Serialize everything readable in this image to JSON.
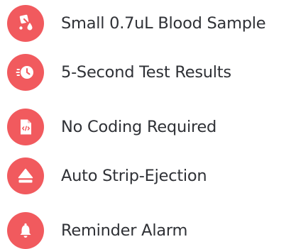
{
  "colors": {
    "accent": "#F15A5E",
    "text": "#2F3136",
    "icon_glyph": "#FFFFFF"
  },
  "features": [
    {
      "label": "Small 0.7uL Blood Sample",
      "icon": "blood-drop-strip-icon"
    },
    {
      "label": "5-Second Test Results",
      "icon": "fast-clock-icon"
    },
    {
      "label": "No Coding Required",
      "icon": "code-file-icon"
    },
    {
      "label": "Auto Strip-Ejection",
      "icon": "eject-icon"
    },
    {
      "label": "Reminder Alarm",
      "icon": "bell-icon"
    }
  ]
}
